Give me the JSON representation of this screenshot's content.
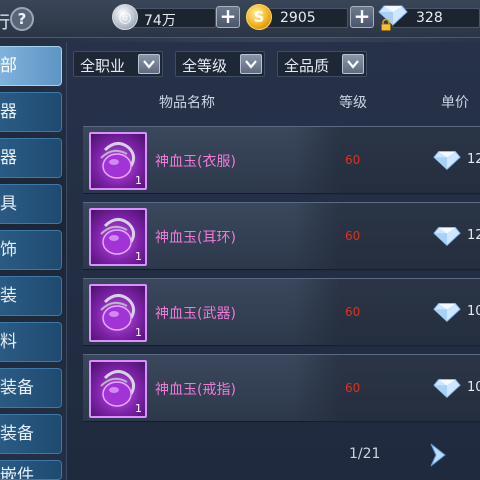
{
  "topbar": {
    "title": "行",
    "help_label": "?",
    "silver": "74万",
    "gold": "2905",
    "diamond": "328",
    "plus": "+"
  },
  "sidebar": {
    "items": [
      {
        "label": "部",
        "active": true
      },
      {
        "label": "器"
      },
      {
        "label": "器"
      },
      {
        "label": "具"
      },
      {
        "label": "饰"
      },
      {
        "label": "装"
      },
      {
        "label": "料"
      },
      {
        "label": "装备"
      },
      {
        "label": "装备"
      },
      {
        "label": "嵌件"
      }
    ]
  },
  "filters": {
    "profession": "全职业",
    "level": "全等级",
    "quality": "全品质"
  },
  "table": {
    "headers": {
      "name": "物品名称",
      "level": "等级",
      "price": "单价"
    },
    "rows": [
      {
        "name": "神血玉(衣服)",
        "level": "60",
        "qty": "1",
        "price": "12"
      },
      {
        "name": "神血玉(耳环)",
        "level": "60",
        "qty": "1",
        "price": "12"
      },
      {
        "name": "神血玉(武器)",
        "level": "60",
        "qty": "1",
        "price": "10"
      },
      {
        "name": "神血玉(戒指)",
        "level": "60",
        "qty": "1",
        "price": "10"
      }
    ]
  },
  "pager": {
    "text": "1/21"
  },
  "colors": {
    "name": "#f07ad8",
    "level": "#e0301e",
    "accent": "#5f95c4"
  }
}
